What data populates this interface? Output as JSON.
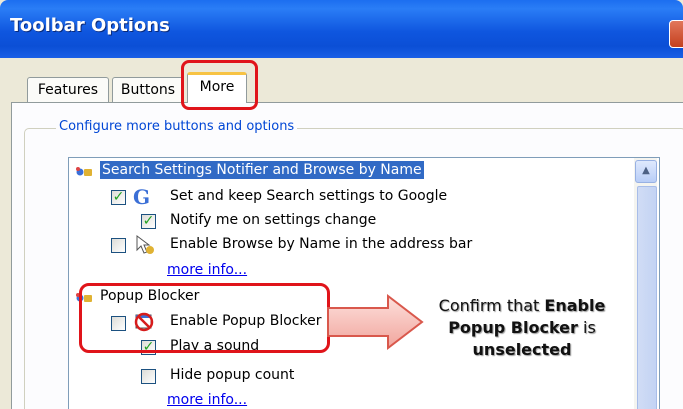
{
  "window": {
    "title": "Toolbar Options"
  },
  "tabs": [
    {
      "label": "Features",
      "active": false
    },
    {
      "label": "Buttons",
      "active": false
    },
    {
      "label": "More",
      "active": true
    }
  ],
  "group": {
    "legend": "Configure more buttons and options"
  },
  "list": {
    "sections": [
      {
        "header": "Search Settings Notifier and Browse by Name",
        "selected": true,
        "items": [
          {
            "label": "Set and keep Search settings to Google",
            "checked": true,
            "icon": "google-g-icon"
          },
          {
            "label": "Notify me on settings change",
            "checked": true
          },
          {
            "label": "Enable Browse by Name in the address bar",
            "checked": false,
            "icon": "browse-cursor-icon"
          },
          {
            "label": "more info...",
            "link": true
          }
        ]
      },
      {
        "header": "Popup Blocker",
        "selected": false,
        "items": [
          {
            "label": "Enable Popup Blocker",
            "checked": false,
            "icon": "no-popup-icon"
          },
          {
            "label": "Play a sound",
            "checked": true
          },
          {
            "label": "Hide popup count",
            "checked": false
          },
          {
            "label": "more info...",
            "link": true
          }
        ]
      }
    ]
  },
  "annotation": {
    "line1_prefix": "Confirm that ",
    "line1_bold": "Enable",
    "line2_bold": "Popup Blocker",
    "line2_suffix": " is",
    "line3_bold": "unselected"
  },
  "colors": {
    "titlebar": "#0b4fd6",
    "selection": "#316ac5",
    "highlight_red": "#e0141a",
    "link": "#0000ee"
  }
}
